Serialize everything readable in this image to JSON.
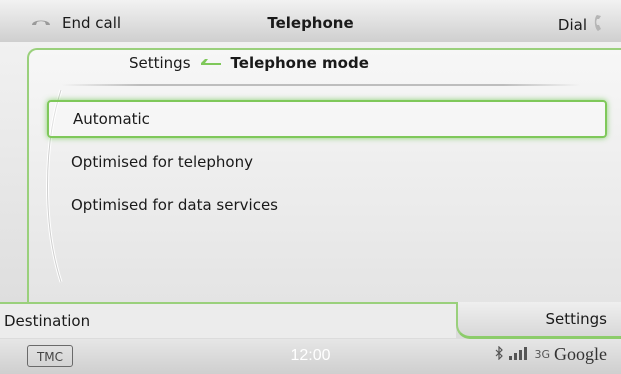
{
  "topbar": {
    "end_call_label": "End call",
    "title": "Telephone",
    "dial_label": "Dial"
  },
  "panel": {
    "breadcrumb_parent": "Settings",
    "breadcrumb_current": "Telephone mode",
    "options": [
      {
        "label": "Automatic",
        "selected": true
      },
      {
        "label": "Optimised for telephony",
        "selected": false
      },
      {
        "label": "Optimised for data services",
        "selected": false
      }
    ]
  },
  "tabs": {
    "left_label": "Destination",
    "right_label": "Settings"
  },
  "statusbar": {
    "tmc_label": "TMC",
    "time": "12:00",
    "network_type": "3G",
    "google_label": "Google"
  },
  "colors": {
    "accent_green": "#8ccc6a",
    "handset_icon": "#a7a7a7"
  }
}
